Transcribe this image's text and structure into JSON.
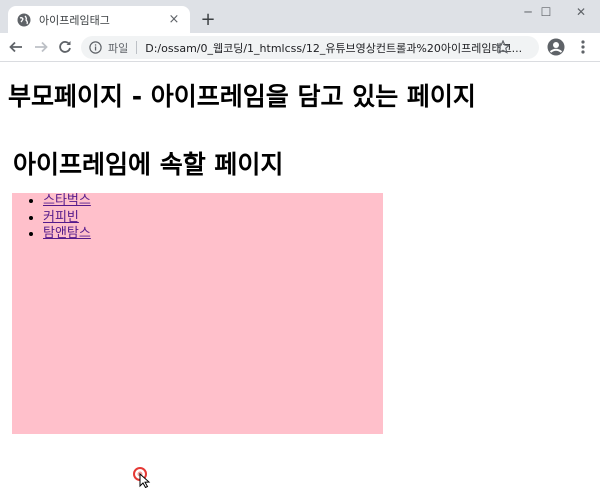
{
  "browser": {
    "tab": {
      "title": "아이프레임태그",
      "close_glyph": "×"
    },
    "new_tab_glyph": "+",
    "window_controls": {
      "minimize": "─",
      "maximize": "☐",
      "close": "✕"
    },
    "address": {
      "scheme_label": "파일",
      "url": "D:/ossam/0_웹코딩/1_htmlcss/12_유튜브영상컨트롤과%20아이프레임태그..."
    },
    "icons": {
      "back": "arrow-left-icon",
      "forward": "arrow-right-icon",
      "reload": "reload-icon",
      "info": "info-icon",
      "star": "star-icon",
      "profile": "account-icon",
      "menu": "kebab-menu-icon"
    }
  },
  "page": {
    "heading": "부모페이지 - 아이프레임을 담고 있는 페이지",
    "iframe": {
      "heading": "아이프레임에 속할 페이지",
      "background": "#ffc0cb",
      "links": [
        {
          "label": "스타벅스"
        },
        {
          "label": "커피빈"
        },
        {
          "label": "탐앤탐스"
        }
      ]
    }
  },
  "colors": {
    "tabstrip": "#dee1e6",
    "omnibox": "#f1f3f4",
    "visited_link": "#551a8b"
  }
}
